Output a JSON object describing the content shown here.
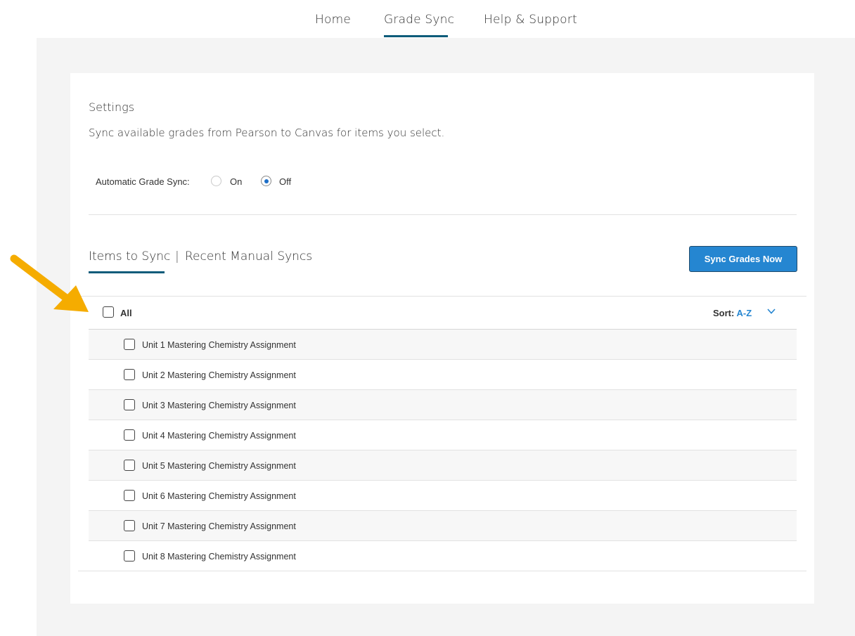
{
  "nav": {
    "items": [
      {
        "label": "Home"
      },
      {
        "label": "Grade Sync",
        "active": true
      },
      {
        "label": "Help & Support"
      }
    ]
  },
  "settings": {
    "title": "Settings",
    "description": "Sync available grades from Pearson to Canvas for items you select.",
    "auto_sync_label": "Automatic Grade Sync:",
    "options": [
      {
        "label": "On",
        "selected": false
      },
      {
        "label": "Off",
        "selected": true
      }
    ]
  },
  "tabs": {
    "items_to_sync": "Items to Sync",
    "separator": "|",
    "recent_manual_syncs": "Recent Manual Syncs"
  },
  "sync_button": {
    "label": "Sync Grades Now"
  },
  "list_header": {
    "all_label": "All",
    "sort_label": "Sort:",
    "sort_value": "A-Z"
  },
  "items": [
    {
      "label": "Unit 1 Mastering Chemistry Assignment",
      "checked": false
    },
    {
      "label": "Unit 2 Mastering Chemistry Assignment",
      "checked": false
    },
    {
      "label": "Unit 3 Mastering Chemistry Assignment",
      "checked": false
    },
    {
      "label": "Unit 4 Mastering Chemistry Assignment",
      "checked": false
    },
    {
      "label": "Unit 5 Mastering Chemistry Assignment",
      "checked": false
    },
    {
      "label": "Unit 6 Mastering Chemistry Assignment",
      "checked": false
    },
    {
      "label": "Unit 7 Mastering Chemistry Assignment",
      "checked": false
    },
    {
      "label": "Unit 8 Mastering Chemistry Assignment",
      "checked": false
    }
  ],
  "colors": {
    "accent": "#2586d1",
    "nav_underline": "#0d5c7a",
    "annotation_arrow": "#f5ac00"
  },
  "annotation": {
    "icon": "arrow-pointer-icon"
  }
}
